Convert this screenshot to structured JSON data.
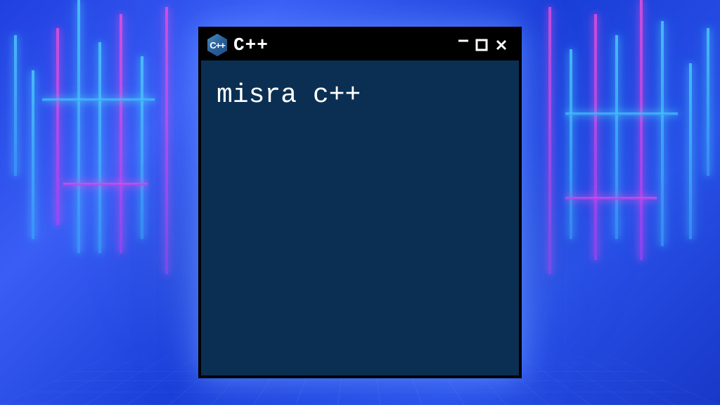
{
  "window": {
    "title": "C++",
    "logo_letters": "C++",
    "body_text": "misra c++",
    "controls": {
      "minimize": "−",
      "maximize": "□",
      "close": "×"
    }
  },
  "icons": {
    "cpp_logo": "cpp-hexagon-logo",
    "minimize": "minimize-icon",
    "maximize": "maximize-icon",
    "close": "close-icon"
  },
  "colors": {
    "window_bg": "#0a2f52",
    "titlebar_bg": "#000000",
    "text": "#ffffff",
    "background_primary": "#1a3fd8",
    "neon_pink": "#ff50dc",
    "neon_cyan": "#50dcff"
  }
}
